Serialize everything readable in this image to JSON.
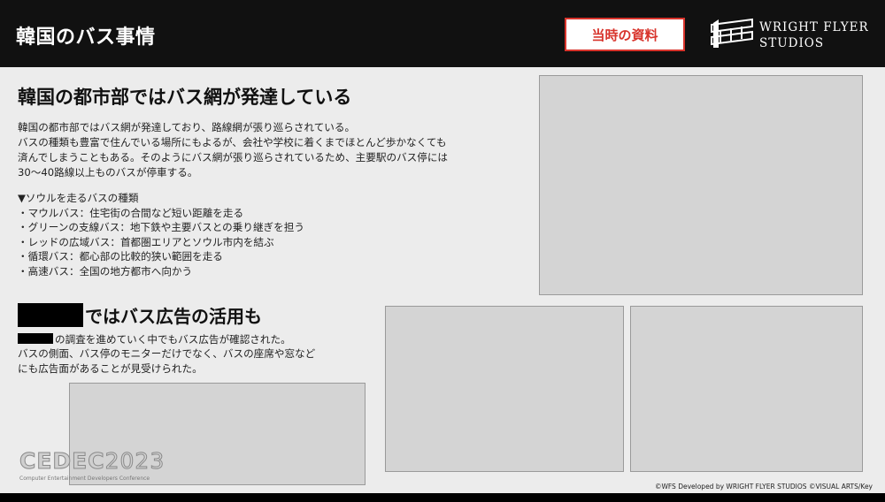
{
  "header": {
    "title": "韓国のバス事情",
    "badge": "当時の資料",
    "logo_line1": "WRIGHT FLYER",
    "logo_line2": "STUDIOS"
  },
  "section1": {
    "heading": "韓国の都市部ではバス網が発達している",
    "paragraph": [
      "韓国の都市部ではバス網が発達しており、路線網が張り巡らされている。",
      "バスの種類も豊富で住んでいる場所にもよるが、会社や学校に着くまでほとんど歩かなくても",
      "済んでしまうこともある。そのようにバス網が張り巡らされているため、主要駅のバス停には",
      "30〜40路線以上ものバスが停車する。"
    ],
    "list_title": "▼ソウルを走るバスの種類",
    "list_items": [
      "・マウルバス：住宅街の合間など短い距離を走る",
      "・グリーンの支線バス：地下鉄や主要バスとの乗り継ぎを担う",
      "・レッドの広域バス：首都圏エリアとソウル市内を結ぶ",
      "・循環バス：都心部の比較的狭い範囲を走る",
      "・高速バス：全国の地方都市へ向かう"
    ]
  },
  "section2": {
    "heading": "ではバス広告の活用も",
    "line1": "の調査を進めていく中でもバス広告が確認された。",
    "line2": "バスの側面、バス停のモニターだけでなく、バスの座席や窓など",
    "line3": "にも広告面があることが見受けられた。"
  },
  "footer": {
    "cedec_word": "CEDEC",
    "cedec_year": "2023",
    "cedec_sub": "Computer Entertainment Developers Conference",
    "copyright": "©WFS Developed by WRIGHT FLYER STUDIOS ©VISUAL ARTS/Key"
  },
  "colors": {
    "accent_red": "#d8342c",
    "header_bg": "#111111",
    "content_bg": "#ececec",
    "placeholder": "#d4d4d4"
  }
}
